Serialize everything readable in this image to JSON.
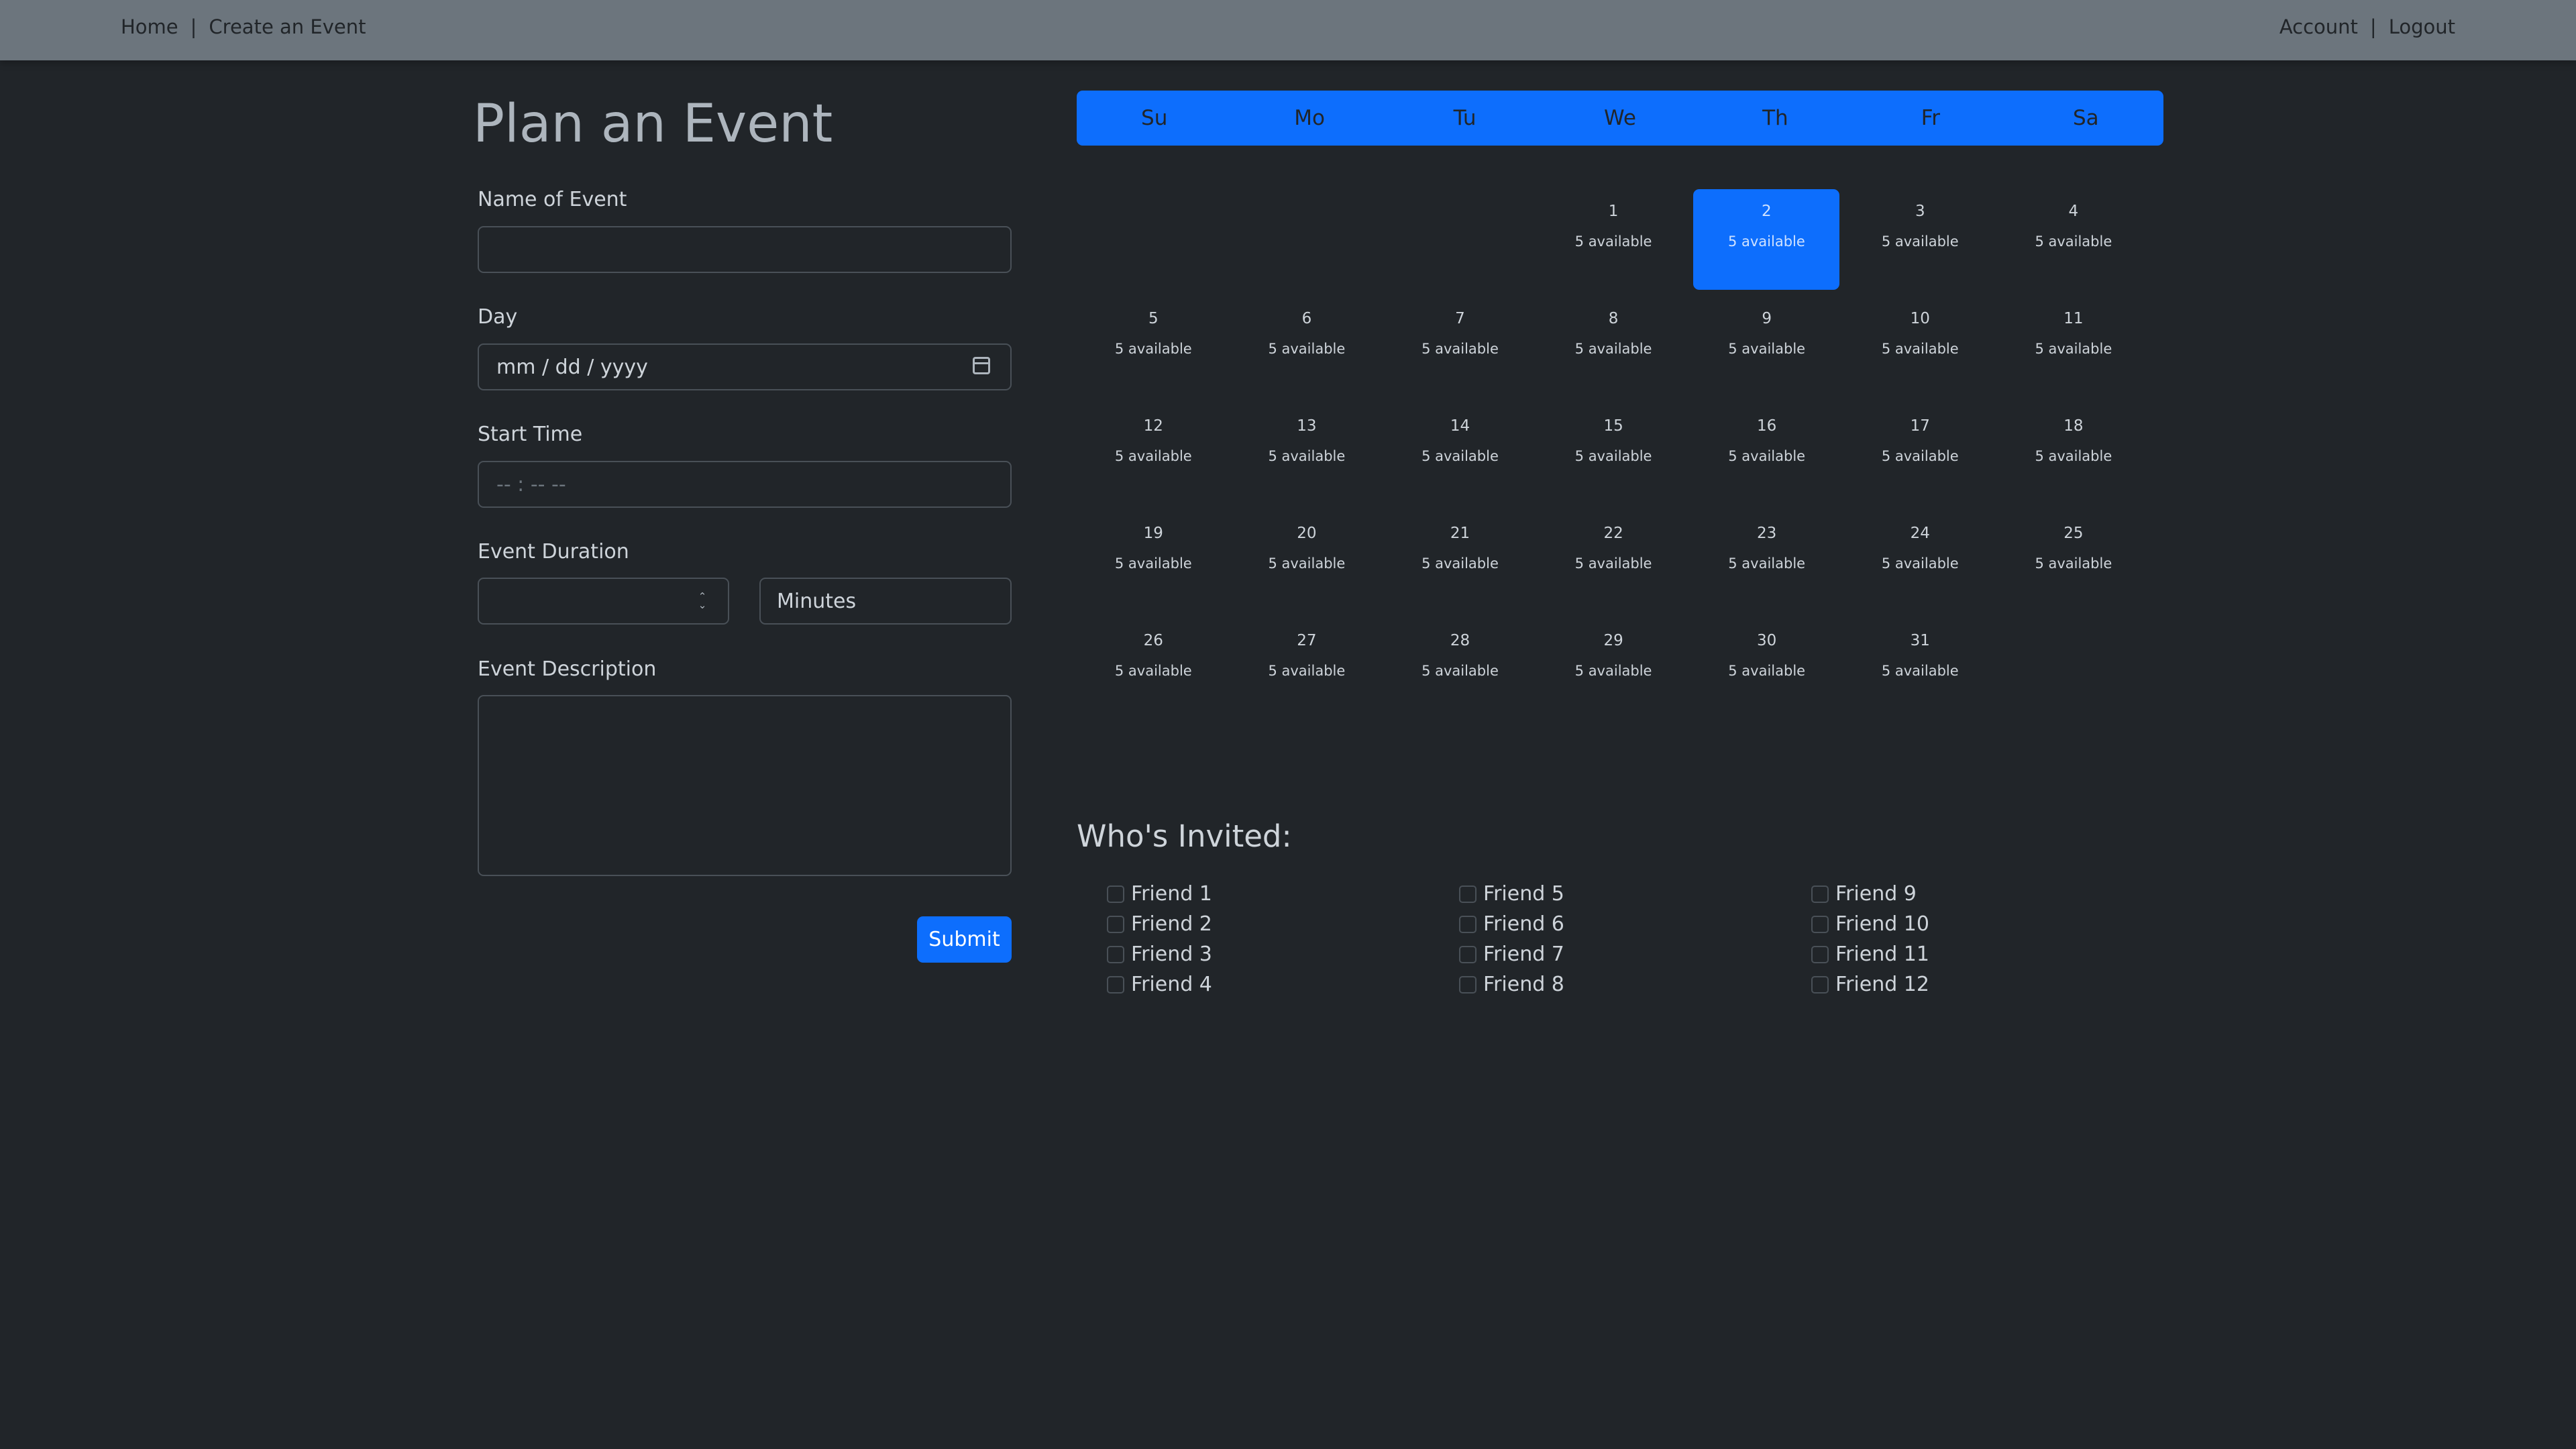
{
  "nav": {
    "home": "Home",
    "create_event": "Create an Event",
    "separator": "|",
    "account": "Account",
    "logout": "Logout"
  },
  "form": {
    "title": "Plan an Event",
    "name_label": "Name of Event",
    "name_value": "",
    "day_label": "Day",
    "day_placeholder": "mm / dd / yyyy",
    "start_label": "Start Time",
    "start_placeholder": "-- : --  --",
    "duration_label": "Event Duration",
    "duration_value": "",
    "duration_unit": "Minutes",
    "description_label": "Event Description",
    "description_value": "",
    "submit_label": "Submit"
  },
  "calendar": {
    "weekdays": [
      "Su",
      "Mo",
      "Tu",
      "We",
      "Th",
      "Fr",
      "Sa"
    ],
    "days": [
      {
        "day": "1",
        "avail": "5 available"
      },
      {
        "day": "2",
        "avail": "5 available",
        "selected": true
      },
      {
        "day": "3",
        "avail": "5 available"
      },
      {
        "day": "4",
        "avail": "5 available"
      },
      {
        "day": "5",
        "avail": "5 available"
      },
      {
        "day": "6",
        "avail": "5 available"
      },
      {
        "day": "7",
        "avail": "5 available"
      },
      {
        "day": "8",
        "avail": "5 available"
      },
      {
        "day": "9",
        "avail": "5 available"
      },
      {
        "day": "10",
        "avail": "5 available"
      },
      {
        "day": "11",
        "avail": "5 available"
      },
      {
        "day": "12",
        "avail": "5 available"
      },
      {
        "day": "13",
        "avail": "5 available"
      },
      {
        "day": "14",
        "avail": "5 available"
      },
      {
        "day": "15",
        "avail": "5 available"
      },
      {
        "day": "16",
        "avail": "5 available"
      },
      {
        "day": "17",
        "avail": "5 available"
      },
      {
        "day": "18",
        "avail": "5 available"
      },
      {
        "day": "19",
        "avail": "5 available"
      },
      {
        "day": "20",
        "avail": "5 available"
      },
      {
        "day": "21",
        "avail": "5 available"
      },
      {
        "day": "22",
        "avail": "5 available"
      },
      {
        "day": "23",
        "avail": "5 available"
      },
      {
        "day": "24",
        "avail": "5 available"
      },
      {
        "day": "25",
        "avail": "5 available"
      },
      {
        "day": "26",
        "avail": "5 available"
      },
      {
        "day": "27",
        "avail": "5 available"
      },
      {
        "day": "28",
        "avail": "5 available"
      },
      {
        "day": "29",
        "avail": "5 available"
      },
      {
        "day": "30",
        "avail": "5 available"
      },
      {
        "day": "31",
        "avail": "5 available"
      }
    ],
    "selected_color": "#0d6efd"
  },
  "invite": {
    "title": "Who's Invited:",
    "friends": [
      "Friend 1",
      "Friend 2",
      "Friend 3",
      "Friend 4",
      "Friend 5",
      "Friend 6",
      "Friend 7",
      "Friend 8",
      "Friend 9",
      "Friend 10",
      "Friend 11",
      "Friend 12"
    ]
  },
  "icons": {
    "day_field": "calendar-icon",
    "duration_field": "spinner-arrows-icon"
  },
  "colors": {
    "accent": "#0d6efd",
    "navbar": "#6c757d",
    "background": "#212529"
  }
}
